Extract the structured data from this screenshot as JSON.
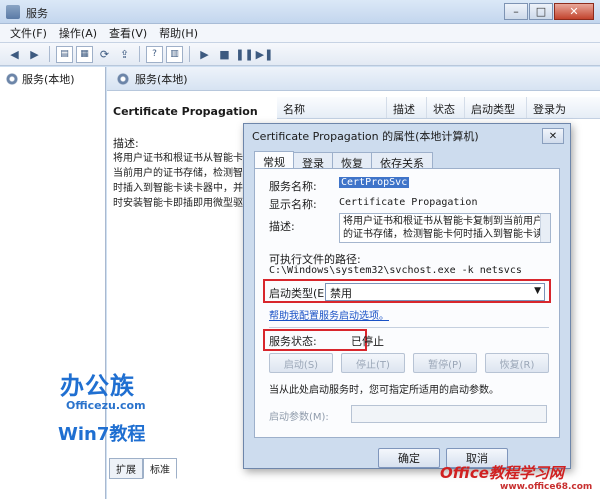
{
  "window": {
    "title": "服务"
  },
  "menu": [
    "文件(F)",
    "操作(A)",
    "查看(V)",
    "帮助(H)"
  ],
  "tree": {
    "item": "服务(本地)"
  },
  "pane": {
    "header": "服务(本地)",
    "service_title": "Certificate Propagation",
    "desc_label": "描述:",
    "desc_lines": [
      "将用户证书和根证书从智能卡复",
      "当前用户的证书存储，检测智能",
      "时插入到智能卡读卡器中，并在",
      "时安装智能卡即插即用微型驱动"
    ],
    "columns": [
      "名称",
      "描述",
      "状态",
      "启动类型",
      "登录为"
    ],
    "bottom_tabs": [
      "扩展",
      "标准"
    ]
  },
  "watermarks": {
    "logo": "办公族",
    "site": "Officezu.com",
    "win7": "Win7教程",
    "office": "Office教程学习网",
    "office_url": "www.office68.com"
  },
  "dialog": {
    "title": "Certificate Propagation 的属性(本地计算机)",
    "tabs": [
      "常规",
      "登录",
      "恢复",
      "依存关系"
    ],
    "service_name_label": "服务名称:",
    "service_name": "CertPropSvc",
    "display_name_label": "显示名称:",
    "display_name": "Certificate Propagation",
    "description_label": "描述:",
    "description": "将用户证书和根证书从智能卡复制到当前用户的证书存储，检测智能卡何时插入到智能卡读",
    "exe_path_label": "可执行文件的路径:",
    "exe_path": "C:\\Windows\\system32\\svchost.exe -k netsvcs",
    "startup_type_label": "启动类型(E):",
    "startup_type": "禁用",
    "config_link": "帮助我配置服务启动选项。",
    "status_label": "服务状态:",
    "status_value": "已停止",
    "buttons": {
      "start": "启动(S)",
      "stop": "停止(T)",
      "pause": "暂停(P)",
      "resume": "恢复(R)"
    },
    "hint": "当从此处启动服务时，您可指定所适用的启动参数。",
    "param_label": "启动参数(M):",
    "ok": "确定",
    "cancel": "取消"
  }
}
